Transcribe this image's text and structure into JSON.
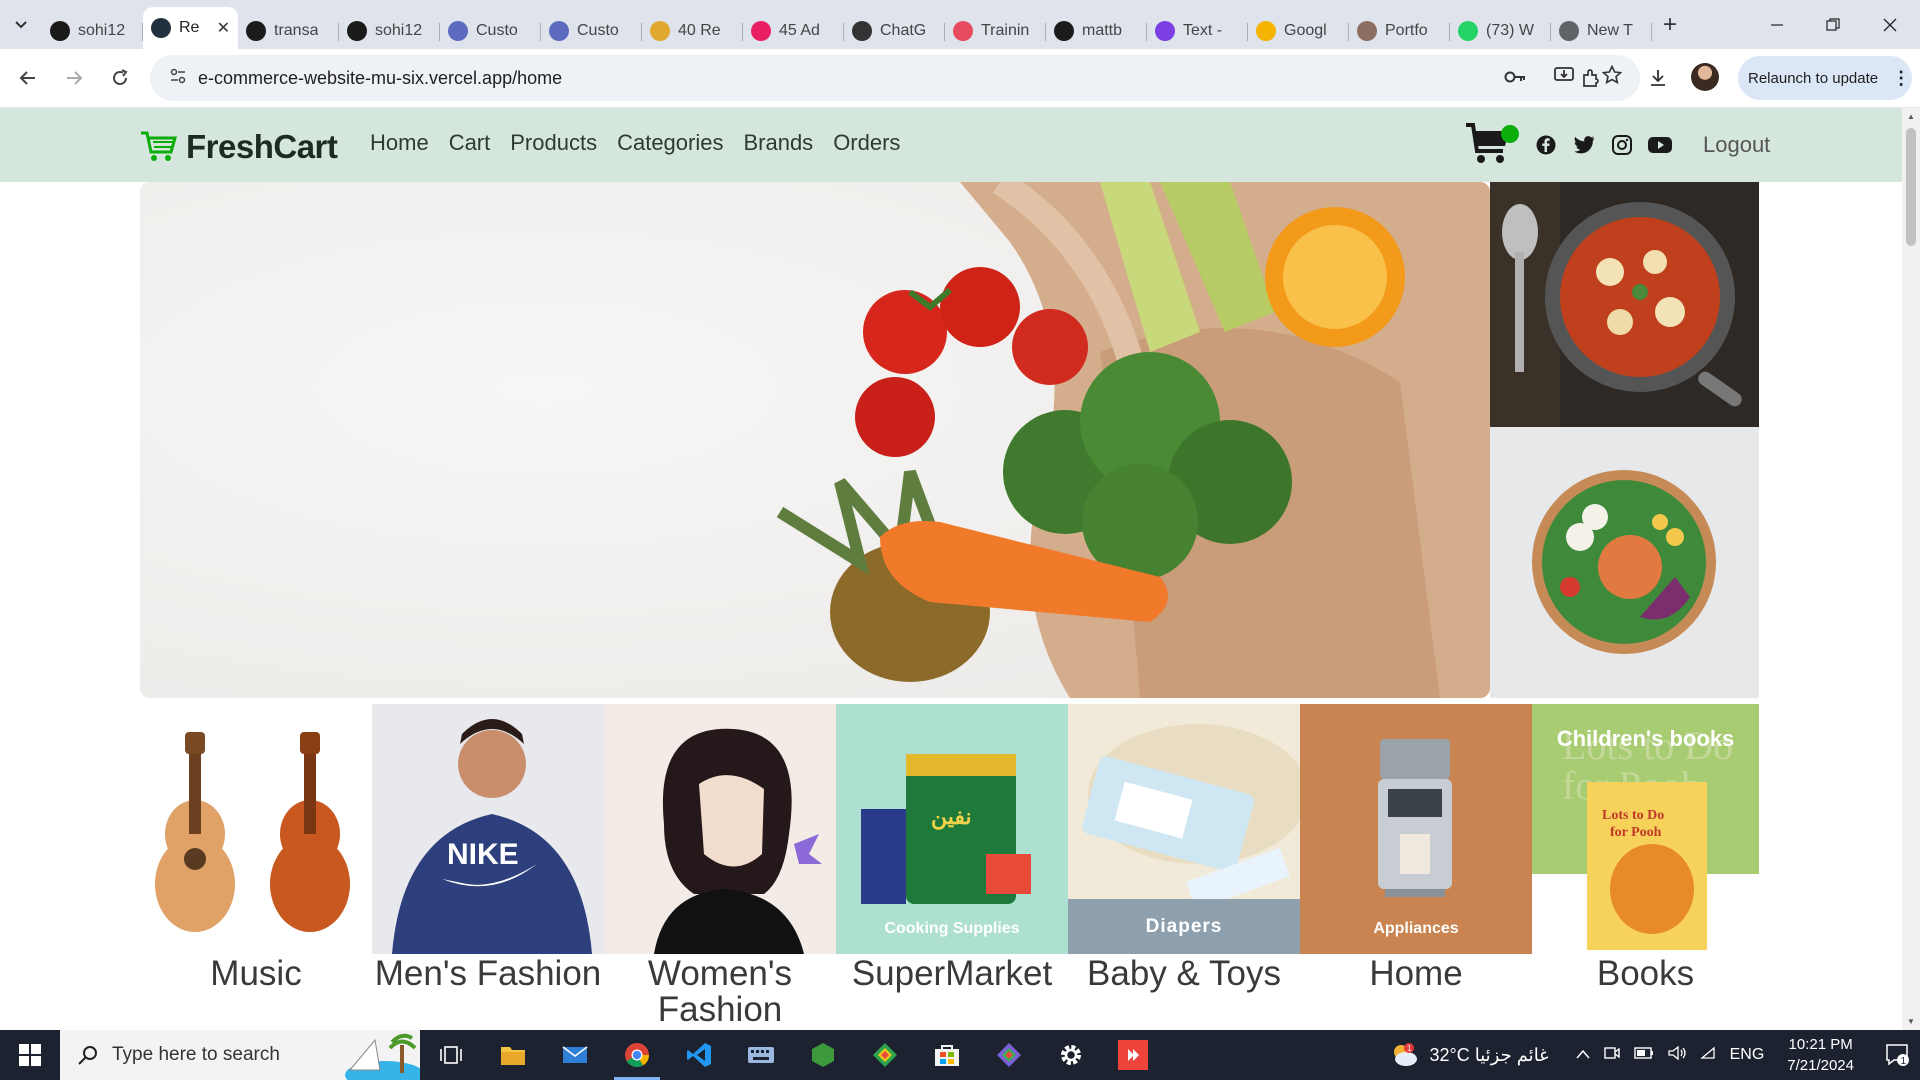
{
  "browser": {
    "tabs": [
      {
        "label": "sohi12",
        "icon": "github-icon",
        "color": "#1a1a1a"
      },
      {
        "label": "Re",
        "icon": "react-icon",
        "color": "#22313f",
        "active": true
      },
      {
        "label": "transa",
        "icon": "app-icon",
        "color": "#1a1a1a"
      },
      {
        "label": "sohi12",
        "icon": "github-icon",
        "color": "#1a1a1a"
      },
      {
        "label": "Custo",
        "icon": "vuetify-icon",
        "color": "#5c6bc0"
      },
      {
        "label": "Custo",
        "icon": "vuetify-icon",
        "color": "#5c6bc0"
      },
      {
        "label": "40 Re",
        "icon": "bookmark-icon",
        "color": "#e0a82e"
      },
      {
        "label": "45 Ad",
        "icon": "ad-icon",
        "color": "#e91e63"
      },
      {
        "label": "ChatG",
        "icon": "openai-icon",
        "color": "#333333"
      },
      {
        "label": "Trainin",
        "icon": "training-icon",
        "color": "#e84a5f"
      },
      {
        "label": "mattb",
        "icon": "github-icon",
        "color": "#1a1a1a"
      },
      {
        "label": "Text -",
        "icon": "b-icon",
        "color": "#7b3fe4"
      },
      {
        "label": "Googl",
        "icon": "google-icon",
        "color": "#f4b400"
      },
      {
        "label": "Portfo",
        "icon": "portfolio-icon",
        "color": "#8d6e63"
      },
      {
        "label": "(73) W",
        "icon": "whatsapp-icon",
        "color": "#25d366"
      },
      {
        "label": "New T",
        "icon": "chrome-icon",
        "color": "#5f6368"
      }
    ],
    "url": "e-commerce-website-mu-six.vercel.app/home",
    "relaunch_label": "Relaunch to update"
  },
  "site": {
    "brand": "FreshCart",
    "accent": "#0aad0a",
    "nav_bg": "#d5e6dd",
    "nav_links": [
      "Home",
      "Cart",
      "Products",
      "Categories",
      "Brands",
      "Orders"
    ],
    "logout": "Logout"
  },
  "categories": [
    {
      "title": "Music"
    },
    {
      "title": "Men's Fashion"
    },
    {
      "title": "Women's Fashion"
    },
    {
      "title": "SuperMarket",
      "overlay": "Cooking Supplies"
    },
    {
      "title": "Baby & Toys",
      "overlay": "Diapers"
    },
    {
      "title": "Home",
      "overlay": "Appliances"
    },
    {
      "title": "Books",
      "overlay": "Children's books"
    }
  ],
  "taskbar": {
    "search_placeholder": "Type here to search",
    "weather": "32°C  غائم جزئيا",
    "language": "ENG",
    "time": "10:21 PM",
    "date": "7/21/2024"
  }
}
